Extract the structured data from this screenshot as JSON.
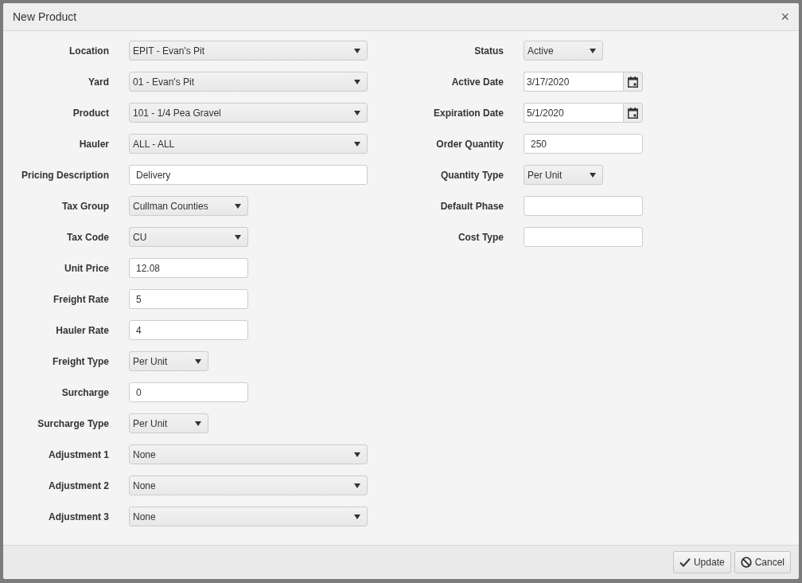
{
  "window": {
    "title": "New Product",
    "close": "×"
  },
  "left_fields": [
    {
      "label": "Location",
      "kind": "select",
      "value": "EPIT - Evan's Pit"
    },
    {
      "label": "Yard",
      "kind": "select",
      "value": "01 - Evan's Pit"
    },
    {
      "label": "Product",
      "kind": "select",
      "value": "101 - 1/4 Pea Gravel"
    },
    {
      "label": "Hauler",
      "kind": "select",
      "value": "ALL - ALL"
    },
    {
      "label": "Pricing Description",
      "kind": "text",
      "value": "Delivery"
    },
    {
      "label": "Tax Group",
      "kind": "select",
      "value": "Cullman Counties"
    },
    {
      "label": "Tax Code",
      "kind": "select",
      "value": "CU"
    },
    {
      "label": "Unit Price",
      "kind": "text",
      "value": "12.08"
    },
    {
      "label": "Freight Rate",
      "kind": "text",
      "value": "5"
    },
    {
      "label": "Hauler Rate",
      "kind": "text",
      "value": "4"
    },
    {
      "label": "Freight Type",
      "kind": "select",
      "value": "Per Unit"
    },
    {
      "label": "Surcharge",
      "kind": "text",
      "value": "0"
    },
    {
      "label": "Surcharge Type",
      "kind": "select",
      "value": "Per Unit"
    },
    {
      "label": "Adjustment 1",
      "kind": "select",
      "value": "None"
    },
    {
      "label": "Adjustment 2",
      "kind": "select",
      "value": "None"
    },
    {
      "label": "Adjustment 3",
      "kind": "select",
      "value": "None"
    }
  ],
  "right_fields": [
    {
      "label": "Status",
      "kind": "select",
      "value": "Active"
    },
    {
      "label": "Active Date",
      "kind": "date",
      "value": "3/17/2020"
    },
    {
      "label": "Expiration Date",
      "kind": "date",
      "value": "5/1/2020"
    },
    {
      "label": "Order Quantity",
      "kind": "text",
      "value": "250"
    },
    {
      "label": "Quantity Type",
      "kind": "select",
      "value": "Per Unit"
    },
    {
      "label": "Default Phase",
      "kind": "text"
    },
    {
      "label": "Cost Type",
      "kind": "text"
    }
  ],
  "buttons": [
    {
      "label": "Update",
      "kind": "confirm"
    },
    {
      "label": "Cancel",
      "kind": "cancel"
    }
  ]
}
